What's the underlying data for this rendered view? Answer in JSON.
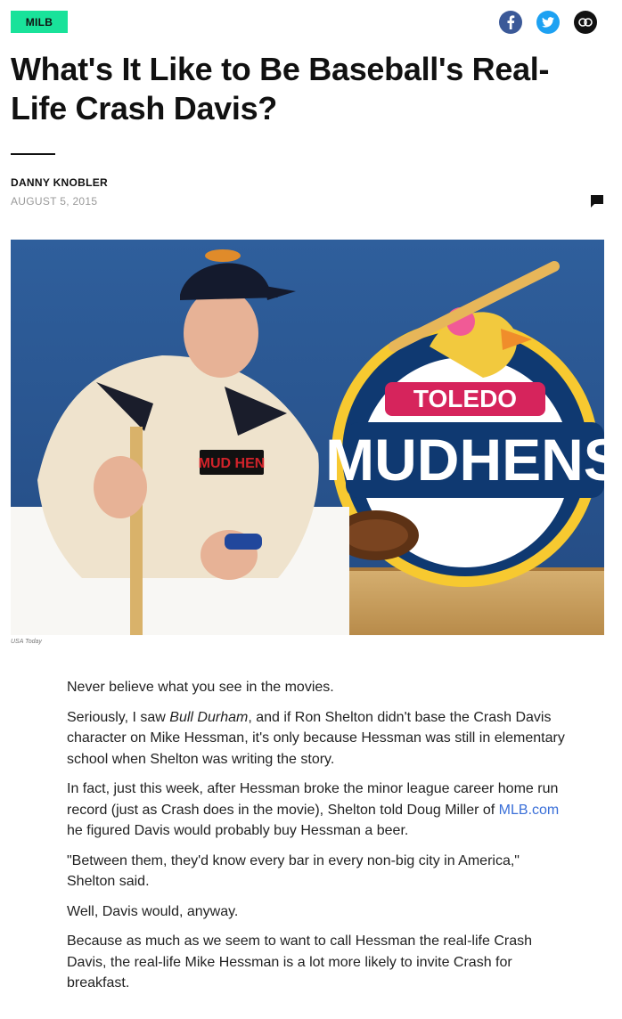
{
  "category": "MILB",
  "share": {
    "facebook": "f",
    "twitter": "t",
    "link": "link"
  },
  "title": "What's It Like to Be Baseball's Real-Life Crash Davis?",
  "author": "DANNY KNOBLER",
  "date": "AUGUST 5, 2015",
  "image": {
    "credit": "USA Today",
    "jersey_text": "MUD HEN",
    "logo_top": "TOLEDO",
    "logo_bottom": "MUDHENS"
  },
  "paragraphs": {
    "p1": "Never believe what you see in the movies.",
    "p2a": "Seriously, I saw ",
    "p2b": "Bull Durham",
    "p2c": ", and if Ron Shelton didn't base the Crash Davis character on Mike Hessman, it's only because Hessman was still in elementary school when Shelton was writing the story.",
    "p3a": "In fact, just this week, after Hessman broke the minor league career home run record (just as Crash does in the movie), Shelton told Doug Miller of ",
    "p3link": "MLB.com",
    "p3b": " he figured Davis would probably buy Hessman a beer.",
    "p4": "\"Between them, they'd know every bar in every non-big city in America,\" Shelton said.",
    "p5": "Well, Davis would, anyway.",
    "p6": "Because as much as we seem to want to call Hessman the real-life Crash Davis, the real-life Mike Hessman is a lot more likely to invite Crash for breakfast."
  },
  "icons": [
    "facebook-icon",
    "twitter-icon",
    "link-icon",
    "comment-icon"
  ],
  "colors": {
    "badge": "#19e29a",
    "facebook": "#3b5998",
    "twitter": "#1da1f2",
    "link": "#3a6fd8"
  }
}
